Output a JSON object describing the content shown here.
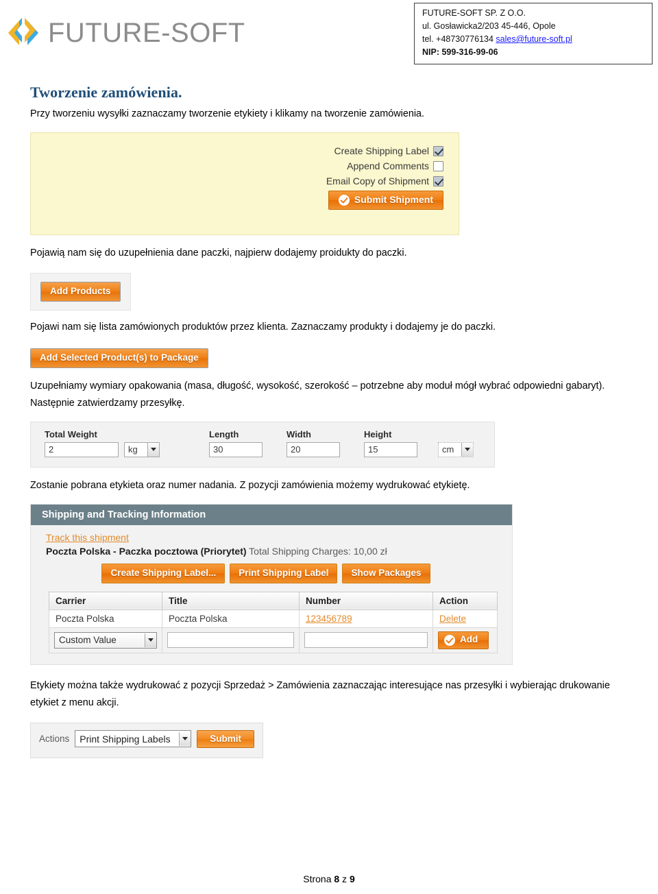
{
  "header": {
    "logo_text": "FUTURE-SOFT",
    "logo_icon": "diamond-chevron-logo-icon",
    "company": {
      "name": "FUTURE-SOFT SP. Z O.O.",
      "address": "ul. Gosławicka2/203 45-446, Opole",
      "phone_prefix": "tel. +48730776134 ",
      "email": "sales@future-soft.pl",
      "nip": "NIP: 599-316-99-06"
    }
  },
  "content": {
    "title": "Tworzenie zamówienia.",
    "p1": "Przy tworzeniu wysyłki zaznaczamy tworzenie etykiety i klikamy na tworzenie zamówienia.",
    "p2": "Pojawią nam się do uzupełnienia dane paczki, najpierw dodajemy proidukty do paczki.",
    "p3": "Pojawi nam się lista zamówionych produktów przez klienta. Zaznaczamy produkty i dodajemy je do paczki.",
    "p4": "Uzupełniamy wymiary opakowania (masa, długość, wysokość, szerokość – potrzebne aby moduł mógł wybrać odpowiedni gabaryt). Następnie zatwierdzamy przesyłkę.",
    "p5": "Zostanie pobrana etykieta oraz numer nadania. Z pozycji zamówienia możemy wydrukować etykietę.",
    "p6": "Etykiety można także wydrukować z pozycji Sprzedaż > Zamówienia zaznaczając interesujące nas przesyłki i wybierając drukowanie etykiet z menu akcji."
  },
  "shipment_panel": {
    "checkboxes": [
      {
        "label": "Create Shipping Label",
        "checked": true
      },
      {
        "label": "Append Comments",
        "checked": false
      },
      {
        "label": "Email Copy of Shipment",
        "checked": true
      }
    ],
    "submit_label": "Submit Shipment"
  },
  "add_products": {
    "button_label": "Add Products"
  },
  "add_selected": {
    "button_label": "Add Selected Product(s) to Package"
  },
  "dimensions": {
    "weight_label": "Total Weight",
    "weight_value": "2",
    "weight_unit": "kg",
    "length_label": "Length",
    "length_value": "30",
    "width_label": "Width",
    "width_value": "20",
    "height_label": "Height",
    "height_value": "15",
    "dim_unit": "cm"
  },
  "tracking": {
    "panel_title": "Shipping and Tracking Information",
    "track_link": "Track this shipment",
    "carrier_bold": "Poczta Polska - Paczka pocztowa (Priorytet)",
    "charges_text": " Total Shipping Charges: 10,00 zł",
    "buttons": [
      "Create Shipping Label...",
      "Print Shipping Label",
      "Show Packages"
    ],
    "table": {
      "headers": [
        "Carrier",
        "Title",
        "Number",
        "Action"
      ],
      "rows": [
        {
          "carrier": "Poczta Polska",
          "title": "Poczta Polska",
          "number": "123456789",
          "action": "Delete"
        }
      ],
      "add_row": {
        "carrier_select": "Custom Value",
        "title_value": "",
        "number_value": "",
        "add_label": "Add"
      }
    }
  },
  "actions_bar": {
    "label": "Actions",
    "selected": "Print Shipping Labels",
    "submit_label": "Submit"
  },
  "footer": {
    "prefix": "Strona ",
    "current": "8",
    "middle": " z ",
    "total": "9"
  },
  "colors": {
    "title_blue": "#1f4e79",
    "orange": "#ef7c12",
    "panel_yellow": "#fbf7ce",
    "track_header": "#6b8089",
    "link_orange": "#e28b2c",
    "email_blue": "#1a1aff"
  }
}
